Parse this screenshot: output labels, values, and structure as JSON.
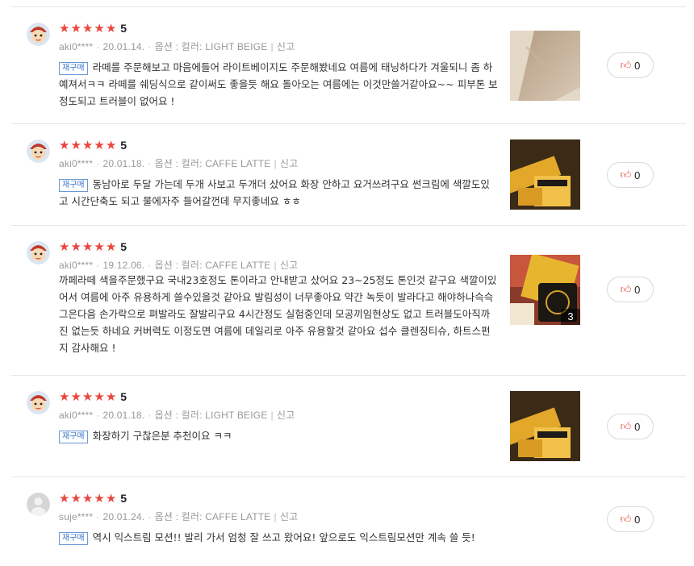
{
  "reviews": [
    {
      "avatar": "cartoon-avatar",
      "score": "5",
      "user": "aki0****",
      "date": "20.01.14.",
      "option": "옵션 : 컬러: LIGHT BEIGE",
      "report": "신고",
      "badge": "재구매",
      "text": "라떼를 주문해보고 마음에들어 라이트베이지도 주문해봤네요 여름에 태닝하다가 겨울되니 좀 하예져서ㅋㅋ 라떼를 쉐딩식으로 같이써도 좋을듯 해요 돌아오는 여름에는 이것만쓸거같아요~~ 피부톤 보정도되고 트러블이 없어요 !",
      "photo": "beige-swatch",
      "photo_count": "",
      "likes": "0"
    },
    {
      "avatar": "cartoon-avatar",
      "score": "5",
      "user": "aki0****",
      "date": "20.01.18.",
      "option": "옵션 : 컬러: CAFFE LATTE",
      "report": "신고",
      "badge": "재구매",
      "text": "동남아로 두달 가는데 두개 사보고 두개더 샀어요 화장 안하고 요거쓰려구요 썬크림에 색깔도있고 시간단축도 되고 물에자주 들어갈껀데 무지좋네요 ㅎㅎ",
      "photo": "product-box",
      "photo_count": "",
      "likes": "0"
    },
    {
      "avatar": "cartoon-avatar",
      "score": "5",
      "user": "aki0****",
      "date": "19.12.06.",
      "option": "옵션 : 컬러: CAFFE LATTE",
      "report": "신고",
      "badge": "",
      "text": "까페라떼 색을주문했구요  국내23호정도 톤이라고 안내받고 샀어요 23~25정도 톤인것 같구요 색깔이있어서 여름에 아주 유용하게 쓸수있을것 같아요 발림성이 너무좋아요 약간 녹듯이 발라다고 해야하나슥슥 그은다음 손가락으로 펴발라도 잘발리구요 4시간정도 실험중인데  모공끼임현상도 없고 트러블도아직까진 없는듯 하네요 커버력도 이정도면 여름에 데일리로  아주 유용할것 같아요 섭수 클렌징티슈, 하트스펀지 감사해요 !",
      "photo": "product-gift",
      "photo_count": "3",
      "likes": "0"
    },
    {
      "avatar": "cartoon-avatar",
      "score": "5",
      "user": "aki0****",
      "date": "20.01.18.",
      "option": "옵션 : 컬러: LIGHT BEIGE",
      "report": "신고",
      "badge": "재구매",
      "text": "화장하기 구찮은분 추천이요 ㅋㅋ",
      "photo": "product-box",
      "photo_count": "",
      "likes": "0"
    },
    {
      "avatar": "default-avatar",
      "score": "5",
      "user": "suje****",
      "date": "20.01.24.",
      "option": "옵션 : 컬러: CAFFE LATTE",
      "report": "신고",
      "badge": "재구매",
      "text": "역시 익스트림 모션!! 발리 가서 엄청 잘 쓰고 왔어요! 앞으로도 익스트림모션만 계속 쓸 듯!",
      "photo": "",
      "photo_count": "",
      "likes": "0"
    }
  ],
  "colors": {
    "star": "#e8473d",
    "badge": "#3d78c9",
    "meta": "#999999"
  }
}
